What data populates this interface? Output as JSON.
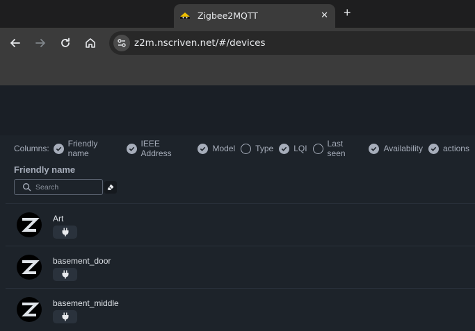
{
  "browser": {
    "tab_title": "Zigbee2MQTT",
    "tab_close": "✕",
    "new_tab": "+",
    "url": "z2m.nscriven.net/#/devices"
  },
  "columns": {
    "label": "Columns:",
    "items": [
      {
        "label": "Friendly name",
        "checked": true
      },
      {
        "label": "IEEE Address",
        "checked": true
      },
      {
        "label": "Model",
        "checked": true
      },
      {
        "label": "Type",
        "checked": false
      },
      {
        "label": "LQI",
        "checked": true
      },
      {
        "label": "Last seen",
        "checked": false
      },
      {
        "label": "Availability",
        "checked": true
      },
      {
        "label": "actions",
        "checked": true
      }
    ]
  },
  "filter": {
    "heading": "Friendly name",
    "search_placeholder": "Search"
  },
  "devices": [
    {
      "name": "Art",
      "power_icon": "plug-icon"
    },
    {
      "name": "basement_door",
      "power_icon": "plug-icon"
    },
    {
      "name": "basement_middle",
      "power_icon": "plug-icon"
    }
  ],
  "colors": {
    "page_bg": "#1d232a",
    "text_muted": "#a6adba",
    "badge_bg": "#2a323c"
  }
}
